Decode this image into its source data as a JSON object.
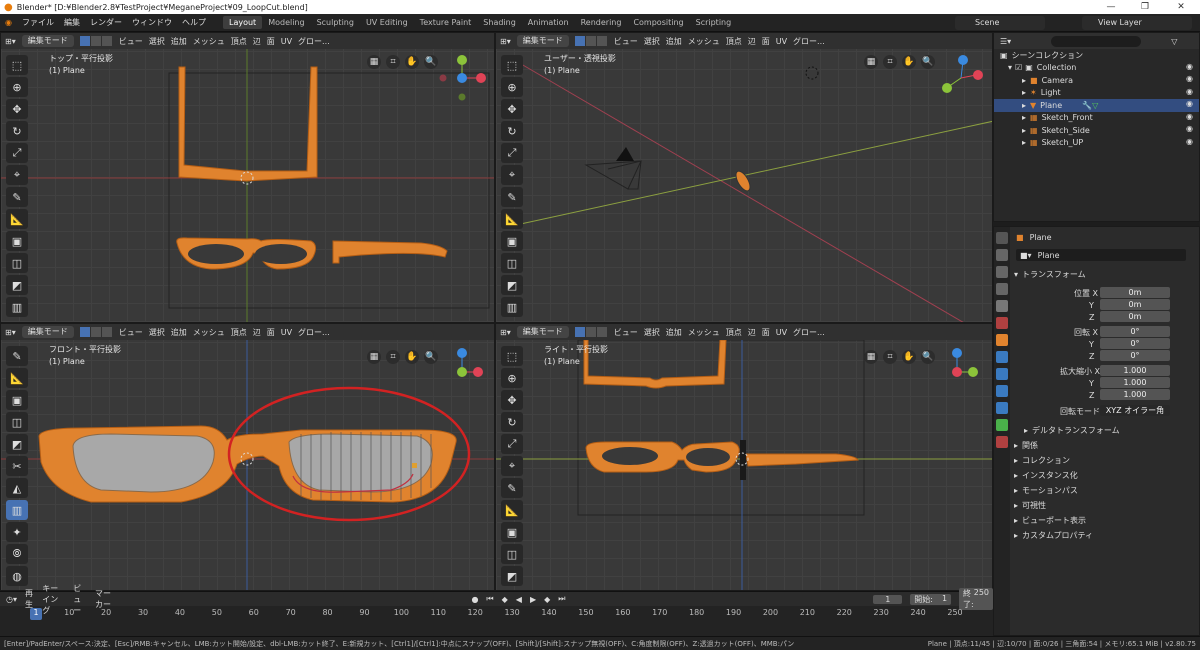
{
  "window": {
    "title": "Blender* [D:¥Blender2.8¥TestProject¥MeganeProject¥09_LoopCut.blend]"
  },
  "menu": {
    "items": [
      "ファイル",
      "編集",
      "レンダー",
      "ウィンドウ",
      "ヘルプ"
    ]
  },
  "workspaces": {
    "active": "Layout",
    "tabs": [
      "Layout",
      "Modeling",
      "Sculpting",
      "UV Editing",
      "Texture Paint",
      "Shading",
      "Animation",
      "Rendering",
      "Compositing",
      "Scripting"
    ]
  },
  "scene": {
    "label": "Scene"
  },
  "view_layer": {
    "label": "View Layer"
  },
  "viewport_header": {
    "mode": "編集モード",
    "menus": [
      "ビュー",
      "選択",
      "追加",
      "メッシュ",
      "頂点",
      "辺",
      "面",
      "UV"
    ],
    "orientation": "グロー..."
  },
  "viewports": {
    "top": {
      "title": "トップ・平行投影",
      "object": "(1) Plane"
    },
    "persp": {
      "title": "ユーザー・透視投影",
      "object": "(1) Plane"
    },
    "front": {
      "title": "フロント・平行投影",
      "object": "(1) Plane"
    },
    "right": {
      "title": "ライト・平行投影",
      "object": "(1) Plane"
    }
  },
  "outliner": {
    "root": "シーンコレクション",
    "collection": "Collection",
    "items": [
      "Camera",
      "Light",
      "Plane",
      "Sketch_Front",
      "Sketch_Side",
      "Sketch_UP"
    ],
    "selected": "Plane"
  },
  "properties": {
    "object_name_header": "Plane",
    "object_name": "Plane",
    "transform_title": "トランスフォーム",
    "location_label": "位置 X",
    "rotation_label": "回転 X",
    "scale_label": "拡大縮小 X",
    "axis_y": "Y",
    "axis_z": "Z",
    "location": [
      "0m",
      "0m",
      "0m"
    ],
    "rotation": [
      "0°",
      "0°",
      "0°"
    ],
    "scale": [
      "1.000",
      "1.000",
      "1.000"
    ],
    "rotation_mode_label": "回転モード",
    "rotation_mode": "XYZ オイラー角",
    "delta": "デルタトランスフォーム",
    "sections": [
      "関係",
      "コレクション",
      "インスタンス化",
      "モーションパス",
      "可視性",
      "ビューポート表示",
      "カスタムプロパティ"
    ]
  },
  "timeline": {
    "menus": [
      "再生",
      "キーイング",
      "ビュー",
      "マーカー"
    ],
    "current_frame": "1",
    "start_label": "開始:",
    "start": "1",
    "end_label": "終了:",
    "end": "250",
    "ticks": [
      "1",
      "10",
      "20",
      "30",
      "40",
      "50",
      "60",
      "70",
      "80",
      "90",
      "100",
      "110",
      "120",
      "130",
      "140",
      "150",
      "160",
      "170",
      "180",
      "190",
      "200",
      "210",
      "220",
      "230",
      "240",
      "250"
    ]
  },
  "status": {
    "left": "[Enter]/PadEnter/スペース:決定、[Esc]/RMB:キャンセル、LMB:カット開始/設定、dbl-LMB:カット終了、E:新規カット、[Ctrl1]/[Ctrl1]:中点にスナップ(OFF)、[Shift]/[Shift]:スナップ無視(OFF)、C:角度制限(OFF)、Z:透過カット(OFF)、MMB:パン",
    "right": "Plane | 頂点:11/45 | 辺:10/70 | 面:0/26 | 三角面:54 | メモリ:65.1 MiB | v2.80.75"
  },
  "colors": {
    "accent": "#4772b3",
    "mesh": "#e0832e",
    "x_axis": "#e04356",
    "y_axis": "#8cc43a",
    "z_axis": "#3a8ae0",
    "highlight_ring": "#d22222"
  }
}
